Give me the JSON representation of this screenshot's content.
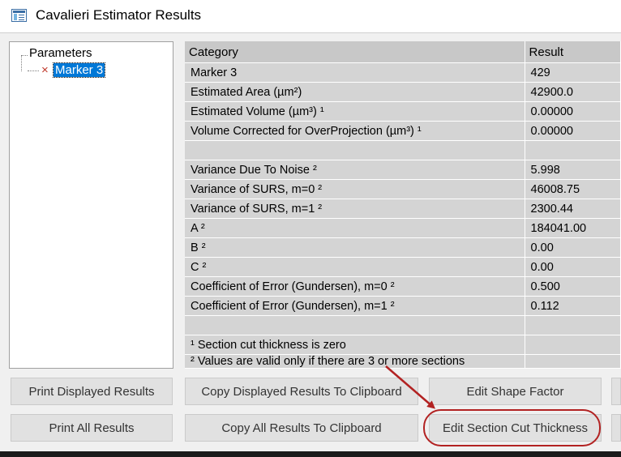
{
  "window": {
    "title": "Cavalieri Estimator Results",
    "icon": "window-app-icon"
  },
  "tree": {
    "root_label": "Parameters",
    "item_marker": "×",
    "selected_label": "Marker 3"
  },
  "grid": {
    "headers": [
      "Category",
      "Result"
    ],
    "rows": [
      [
        "Marker 3",
        "429"
      ],
      [
        "Estimated Area (µm²)",
        "42900.0"
      ],
      [
        "Estimated Volume (µm³) ¹",
        "0.00000"
      ],
      [
        "Volume Corrected for OverProjection (µm³) ¹",
        "0.00000"
      ],
      [
        "",
        ""
      ],
      [
        "Variance Due To Noise ²",
        "5.998"
      ],
      [
        "Variance of SURS, m=0 ²",
        "46008.75"
      ],
      [
        "Variance of SURS, m=1 ²",
        "2300.44"
      ],
      [
        "A ²",
        "184041.00"
      ],
      [
        "B ²",
        "0.00"
      ],
      [
        "C ²",
        "0.00"
      ],
      [
        "Coefficient of Error (Gundersen), m=0 ²",
        "0.500"
      ],
      [
        "Coefficient of Error (Gundersen), m=1 ²",
        "0.112"
      ],
      [
        "",
        ""
      ],
      [
        "¹  Section cut thickness is zero",
        ""
      ],
      [
        "²  Values are valid only if there are 3 or more sections",
        ""
      ]
    ]
  },
  "buttons": {
    "print_displayed": "Print Displayed Results",
    "copy_displayed": "Copy Displayed Results To Clipboard",
    "edit_shape_factor": "Edit Shape Factor",
    "print_all": "Print All Results",
    "copy_all": "Copy All Results To Clipboard",
    "edit_section_cut": "Edit Section Cut Thickness"
  },
  "annotation": {
    "color": "#b22222"
  }
}
